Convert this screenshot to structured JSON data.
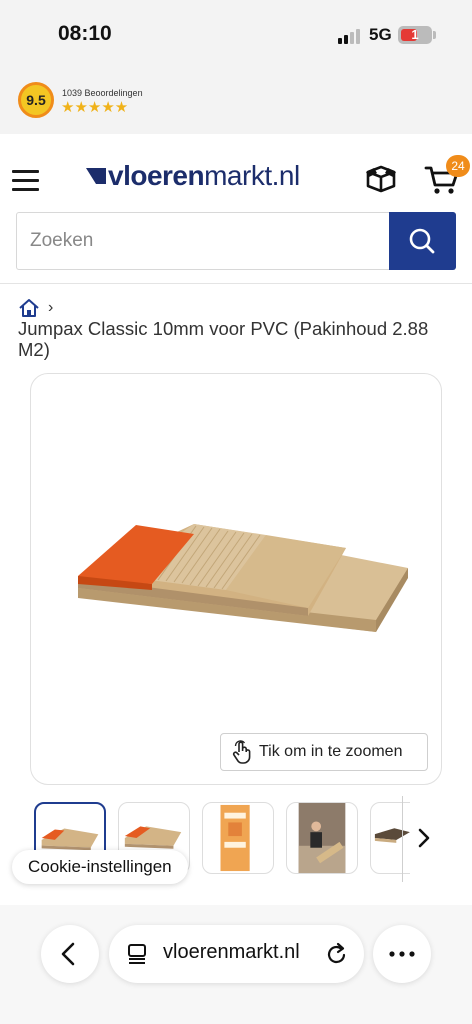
{
  "status_bar": {
    "time": "08:10",
    "network": "5G",
    "battery_level": "1",
    "battery_color": "#e53935"
  },
  "reviews": {
    "score": "9.5",
    "count_label": "1039 Beoordelingen",
    "stars": "★★★★★",
    "star_color": "#f0b21a"
  },
  "header": {
    "logo_bold": "vloeren",
    "logo_light": "markt.nl",
    "brand_color": "#1c2d6b",
    "cart_count": "24",
    "cart_badge_color": "#f08c1a",
    "icons": [
      "hamburger-menu-icon",
      "box-icon",
      "cart-icon"
    ]
  },
  "search": {
    "placeholder": "Zoeken",
    "value": "",
    "button_color": "#1f3c8f"
  },
  "breadcrumb": {
    "separator": "›"
  },
  "product": {
    "title": "Jumpax Classic 10mm voor PVC (Pakinhoud 2.88 M2)",
    "zoom_label": "Tik om in te zoomen"
  },
  "thumbnails": {
    "active_index": 0,
    "count_visible": 5
  },
  "cookie": {
    "label": "Cookie-instellingen"
  },
  "browser": {
    "address": "vloerenmarkt.nl"
  }
}
